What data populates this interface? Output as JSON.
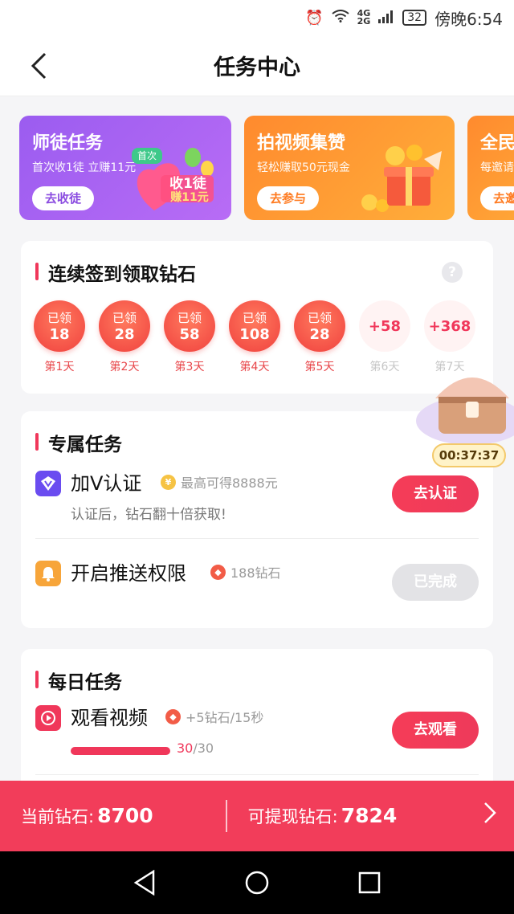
{
  "status_bar": {
    "network": "4G",
    "network2": "2G",
    "battery": "32",
    "time": "傍晚6:54"
  },
  "header": {
    "title": "任务中心"
  },
  "banners": [
    {
      "title": "师徒任务",
      "subtitle": "首次收1徒 立赚11元",
      "button": "去收徒",
      "decor": [
        "首次",
        "收1徒",
        "赚11元"
      ]
    },
    {
      "title": "拍视频集赞",
      "subtitle": "轻松赚取50元现金",
      "button": "去参与"
    },
    {
      "title": "全民",
      "subtitle": "每邀请",
      "button": "去邀"
    }
  ],
  "checkin": {
    "title": "连续签到领取钻石",
    "help": "?",
    "days": [
      {
        "top": "已领",
        "value": "18",
        "label": "第1天"
      },
      {
        "top": "已领",
        "value": "28",
        "label": "第2天"
      },
      {
        "top": "已领",
        "value": "58",
        "label": "第3天"
      },
      {
        "top": "已领",
        "value": "108",
        "label": "第4天"
      },
      {
        "top": "已领",
        "value": "28",
        "label": "第5天"
      },
      {
        "value": "+58",
        "label": "第6天"
      },
      {
        "value": "+368",
        "label": "第7天"
      }
    ],
    "chest_timer": "00:37:37"
  },
  "exclusive": {
    "title": "专属任务",
    "tasks": [
      {
        "icon": "V",
        "name": "加V认证",
        "tag": "最高可得8888元",
        "tag_icon": "¥",
        "desc": "认证后，钻石翻十倍获取!",
        "button": "去认证"
      },
      {
        "icon": "bell",
        "name": "开启推送权限",
        "tag": "188钻石",
        "button": "已完成"
      }
    ]
  },
  "daily": {
    "title": "每日任务",
    "tasks": [
      {
        "icon": "play",
        "name": "观看视频",
        "tag": "+5钻石/15秒",
        "progress_done": "30",
        "progress_total": "/30",
        "progress": 1.0,
        "button": "去观看"
      }
    ]
  },
  "bottom_bar": {
    "current_label": "当前钻石:",
    "current_value": "8700",
    "withdraw_label": "可提现钻石:",
    "withdraw_value": "7824"
  },
  "colors": {
    "accent": "#f23d5a",
    "purple": "#9b5cf0",
    "orange": "#ff8a2e"
  }
}
